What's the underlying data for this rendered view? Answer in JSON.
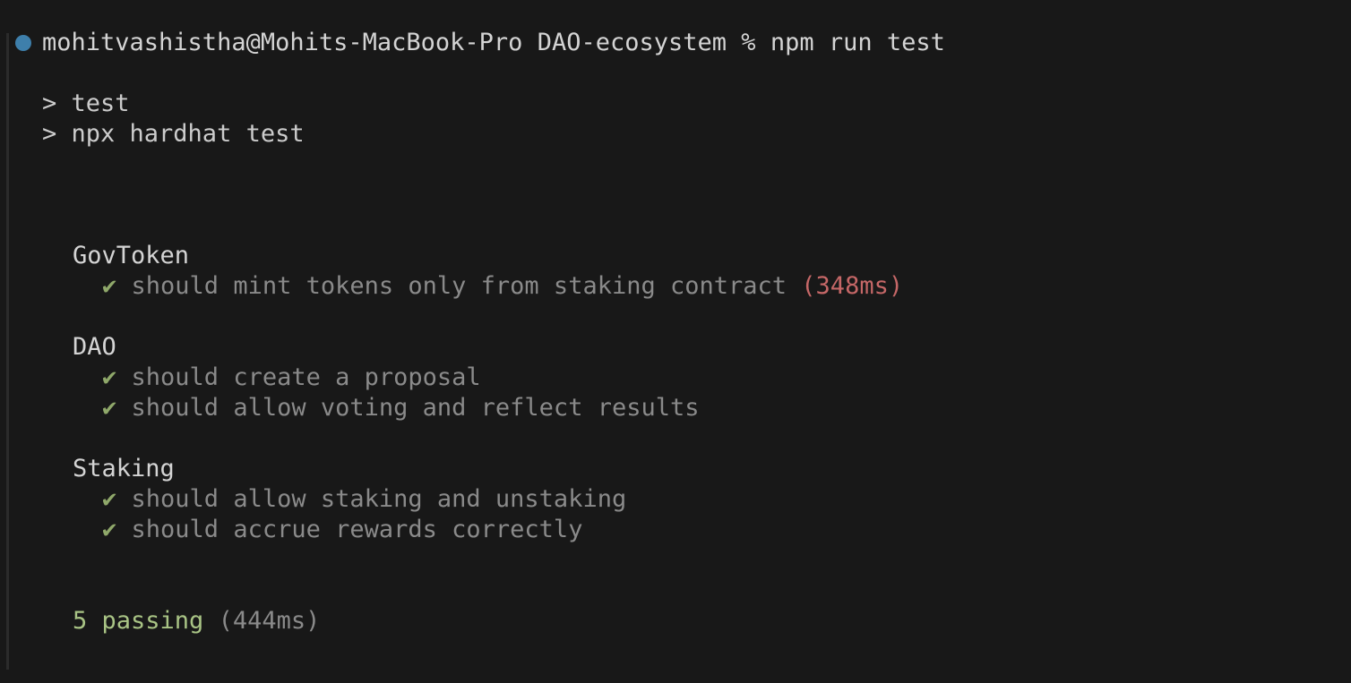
{
  "prompt": {
    "user_host": "mohitvashistha@Mohits-MacBook-Pro",
    "cwd": "DAO-ecosystem",
    "symbol": "%",
    "command": "npm run test"
  },
  "script_lines": [
    "> test",
    "> npx hardhat test"
  ],
  "suites": [
    {
      "name": "GovToken",
      "tests": [
        {
          "mark": "✔",
          "title": "should mint tokens only from staking contract",
          "duration": "(348ms)"
        }
      ]
    },
    {
      "name": "DAO",
      "tests": [
        {
          "mark": "✔",
          "title": "should create a proposal"
        },
        {
          "mark": "✔",
          "title": "should allow voting and reflect results"
        }
      ]
    },
    {
      "name": "Staking",
      "tests": [
        {
          "mark": "✔",
          "title": "should allow staking and unstaking"
        },
        {
          "mark": "✔",
          "title": "should accrue rewards correctly"
        }
      ]
    }
  ],
  "summary": {
    "passing": "5 passing",
    "duration": "(444ms)"
  },
  "colors": {
    "background": "#181818",
    "prompt_dot": "#3e7fab",
    "check": "#8fa86a",
    "slow_duration": "#c56767",
    "passing": "#a9c485"
  }
}
